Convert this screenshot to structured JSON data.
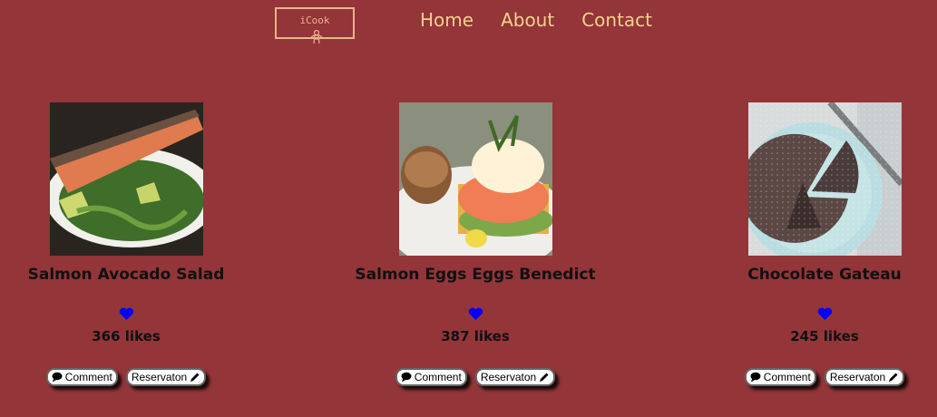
{
  "logo": {
    "text": "iCook"
  },
  "nav": {
    "items": [
      "Home",
      "About",
      "Contact"
    ]
  },
  "recipes": [
    {
      "title": "Salmon Avocado Salad",
      "likes": "366 likes"
    },
    {
      "title": "Salmon Eggs Eggs Benedict",
      "likes": "387 likes"
    },
    {
      "title": "Chocolate Gateau",
      "likes": "245 likes"
    }
  ],
  "buttons": {
    "comment": "Comment",
    "reservation": "Reservaton"
  },
  "colors": {
    "background": "#933539",
    "nav_text": "#f5d08f",
    "heart": "#0000ff"
  }
}
